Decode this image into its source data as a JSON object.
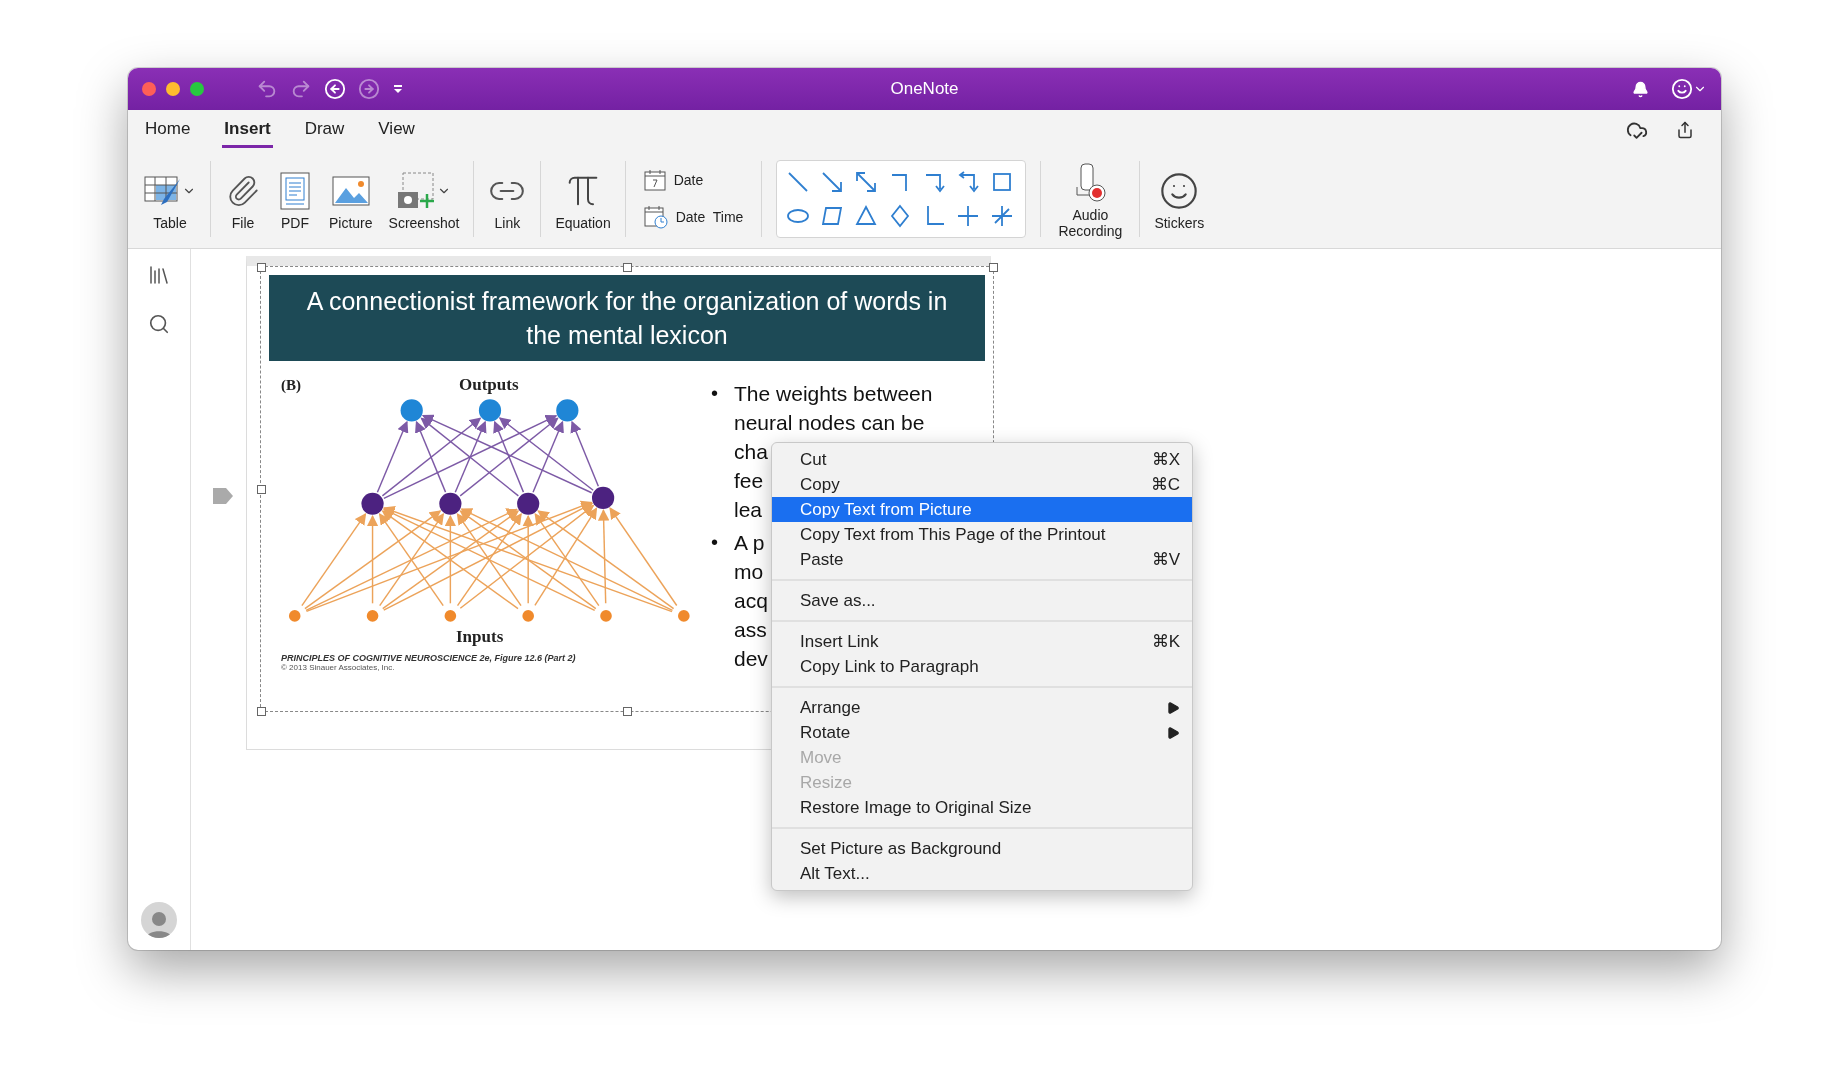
{
  "window": {
    "title": "OneNote"
  },
  "title_bar": {
    "nav": [
      {
        "kind": "undo",
        "disabled": true
      },
      {
        "kind": "redo",
        "disabled": true
      },
      {
        "kind": "back",
        "disabled": false
      },
      {
        "kind": "forward",
        "disabled": true
      },
      {
        "kind": "customize",
        "disabled": false
      }
    ]
  },
  "tabs": [
    {
      "label": "Home",
      "selected": false
    },
    {
      "label": "Insert",
      "selected": true
    },
    {
      "label": "Draw",
      "selected": false
    },
    {
      "label": "View",
      "selected": false
    }
  ],
  "ribbon": {
    "groups": [
      {
        "kind": "buttons",
        "items": [
          {
            "kind": "table",
            "label": "Table",
            "caret": true
          }
        ]
      },
      {
        "kind": "buttons",
        "items": [
          {
            "kind": "file",
            "label": "File",
            "caret": false
          },
          {
            "kind": "pdf",
            "label": "PDF",
            "caret": false
          },
          {
            "kind": "picture",
            "label": "Picture",
            "caret": false
          },
          {
            "kind": "screenshot",
            "label": "Screenshot",
            "caret": true
          }
        ]
      },
      {
        "kind": "buttons",
        "items": [
          {
            "kind": "link",
            "label": "Link",
            "caret": false
          }
        ]
      },
      {
        "kind": "buttons",
        "items": [
          {
            "kind": "equation",
            "label": "Equation",
            "caret": false
          }
        ]
      },
      {
        "kind": "small",
        "items": [
          {
            "kind": "date",
            "label": "Date"
          },
          {
            "kind": "date-time",
            "label": "Date  Time"
          }
        ]
      },
      {
        "kind": "shapes"
      },
      {
        "kind": "buttons",
        "items": [
          {
            "kind": "audio",
            "label": "Audio Recording",
            "caret": false
          }
        ]
      },
      {
        "kind": "buttons",
        "items": [
          {
            "kind": "stickers",
            "label": "Stickers",
            "caret": false
          }
        ]
      }
    ]
  },
  "note": {
    "title": "A connectionist framework for the organization of words in the mental lexicon",
    "figure": {
      "panel": "(B)",
      "top_label": "Outputs",
      "bottom_label": "Inputs",
      "caption": "PRINCIPLES OF COGNITIVE NEUROSCIENCE 2e, Figure 12.6 (Part 2)",
      "credit": "© 2013 Sinauer Associates, Inc."
    },
    "bullets": [
      {
        "marker": "•",
        "lines": [
          "The weights between",
          "neural nodes can be",
          "cha",
          "fee",
          "lea"
        ]
      },
      {
        "marker": "•",
        "lines": [
          "A p",
          "mo",
          "acq",
          "ass",
          "dev"
        ]
      }
    ]
  },
  "context_menu": {
    "groups": [
      {
        "items": [
          {
            "label": "Cut",
            "shortcut": "⌘X",
            "selected": false,
            "disabled": false,
            "submenu": false
          },
          {
            "label": "Copy",
            "shortcut": "⌘C",
            "selected": false,
            "disabled": false,
            "submenu": false
          },
          {
            "label": "Copy Text from Picture",
            "selected": true,
            "disabled": false,
            "submenu": false
          },
          {
            "label": "Copy Text from This Page of the Printout",
            "selected": false,
            "disabled": false,
            "submenu": false
          },
          {
            "label": "Paste",
            "shortcut": "⌘V",
            "selected": false,
            "disabled": false,
            "submenu": false
          }
        ]
      },
      {
        "items": [
          {
            "label": "Save as...",
            "selected": false,
            "disabled": false,
            "submenu": false
          }
        ]
      },
      {
        "items": [
          {
            "label": "Insert Link",
            "shortcut": "⌘K",
            "selected": false,
            "disabled": false,
            "submenu": false
          },
          {
            "label": "Copy Link to Paragraph",
            "selected": false,
            "disabled": false,
            "submenu": false
          }
        ]
      },
      {
        "items": [
          {
            "label": "Arrange",
            "selected": false,
            "disabled": false,
            "submenu": true
          },
          {
            "label": "Rotate",
            "selected": false,
            "disabled": false,
            "submenu": true
          },
          {
            "label": "Move",
            "selected": false,
            "disabled": true,
            "submenu": false
          },
          {
            "label": "Resize",
            "selected": false,
            "disabled": true,
            "submenu": false
          },
          {
            "label": "Restore Image to Original Size",
            "selected": false,
            "disabled": false,
            "submenu": false
          }
        ]
      },
      {
        "items": [
          {
            "label": "Set Picture as Background",
            "selected": false,
            "disabled": false,
            "submenu": false
          },
          {
            "label": "Alt Text...",
            "selected": false,
            "disabled": false,
            "submenu": false
          }
        ]
      }
    ]
  }
}
